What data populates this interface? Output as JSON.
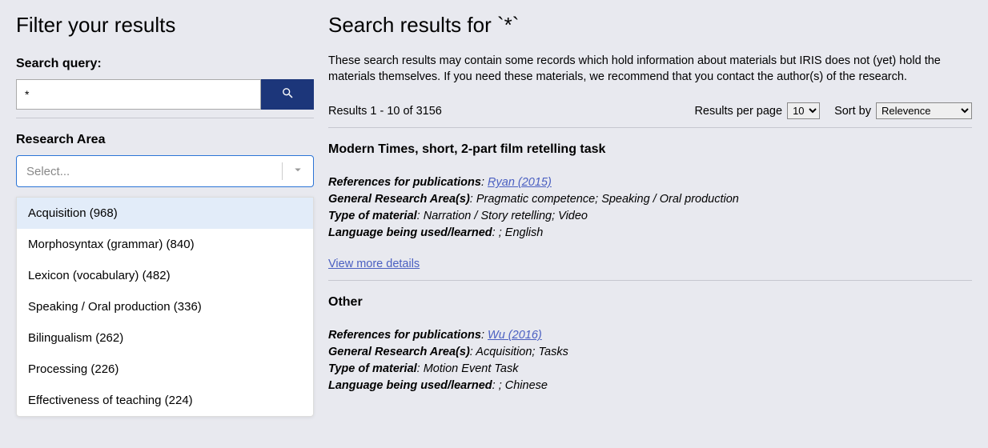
{
  "sidebar": {
    "title": "Filter your results",
    "search_label": "Search query:",
    "search_value": "*",
    "research_area_label": "Research Area",
    "select_placeholder": "Select...",
    "options": [
      {
        "label": "Acquisition (968)",
        "highlight": true
      },
      {
        "label": "Morphosyntax (grammar) (840)",
        "highlight": false
      },
      {
        "label": "Lexicon (vocabulary) (482)",
        "highlight": false
      },
      {
        "label": "Speaking / Oral production (336)",
        "highlight": false
      },
      {
        "label": "Bilingualism (262)",
        "highlight": false
      },
      {
        "label": "Processing (226)",
        "highlight": false
      },
      {
        "label": "Effectiveness of teaching (224)",
        "highlight": false
      }
    ]
  },
  "main": {
    "title": "Search results for `*`",
    "disclaimer": "These search results may contain some records which hold information about materials but IRIS does not (yet) hold the materials themselves. If you need these materials, we recommend that you contact the author(s) of the research.",
    "count": "Results 1 - 10 of 3156",
    "rpp_label": "Results per page",
    "rpp_value": "10",
    "sort_label": "Sort by",
    "sort_value": "Relevence",
    "results": [
      {
        "title": "Modern Times, short, 2-part film retelling task",
        "ref_label": "References for publications",
        "ref_link": "Ryan (2015)",
        "area_label": "General Research Area(s)",
        "area_value": ": Pragmatic competence; Speaking / Oral production",
        "type_label": "Type of material",
        "type_value": ": Narration / Story retelling; Video",
        "lang_label": "Language being used/learned",
        "lang_value": ": ; English",
        "view_more": "View more details"
      },
      {
        "title": "Other",
        "ref_label": "References for publications",
        "ref_link": "Wu (2016)",
        "area_label": "General Research Area(s)",
        "area_value": ": Acquisition; Tasks",
        "type_label": "Type of material",
        "type_value": ": Motion Event Task",
        "lang_label": "Language being used/learned",
        "lang_value": ": ; Chinese"
      }
    ]
  }
}
